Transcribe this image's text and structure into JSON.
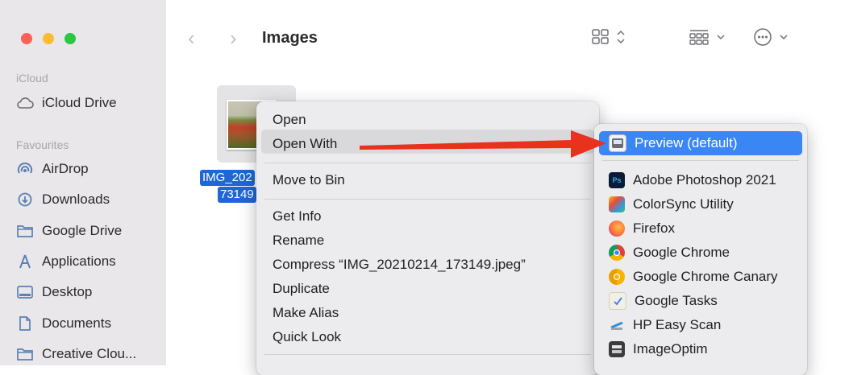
{
  "sidebar": {
    "icloud_header": "iCloud",
    "icloud_drive": "iCloud Drive",
    "favourites_header": "Favourites",
    "items": [
      {
        "label": "AirDrop",
        "icon": "airdrop-icon"
      },
      {
        "label": "Downloads",
        "icon": "downloads-icon"
      },
      {
        "label": "Google Drive",
        "icon": "folder-icon"
      },
      {
        "label": "Applications",
        "icon": "applications-icon"
      },
      {
        "label": "Desktop",
        "icon": "desktop-icon"
      },
      {
        "label": "Documents",
        "icon": "document-icon"
      },
      {
        "label": "Creative Clou...",
        "icon": "folder-icon"
      }
    ]
  },
  "toolbar": {
    "back": "‹",
    "forward": "›",
    "title": "Images"
  },
  "file": {
    "name_line1": "IMG_202",
    "name_line2": "73149"
  },
  "context_menu": {
    "open": "Open",
    "open_with": "Open With",
    "move_to_bin": "Move to Bin",
    "get_info": "Get Info",
    "rename": "Rename",
    "compress": "Compress “IMG_20210214_173149.jpeg”",
    "duplicate": "Duplicate",
    "make_alias": "Make Alias",
    "quick_look": "Quick Look"
  },
  "submenu": {
    "default_app": "Preview (default)",
    "apps": [
      {
        "label": "Adobe Photoshop 2021",
        "icon": "photoshop-icon"
      },
      {
        "label": "ColorSync Utility",
        "icon": "colorsync-icon"
      },
      {
        "label": "Firefox",
        "icon": "firefox-icon"
      },
      {
        "label": "Google Chrome",
        "icon": "chrome-icon"
      },
      {
        "label": "Google Chrome Canary",
        "icon": "chrome-canary-icon"
      },
      {
        "label": "Google Tasks",
        "icon": "google-tasks-icon"
      },
      {
        "label": "HP Easy Scan",
        "icon": "hp-easy-scan-icon"
      },
      {
        "label": "ImageOptim",
        "icon": "imageoptim-icon"
      }
    ]
  },
  "colors": {
    "accent": "#3a86f5",
    "arrow": "#e8321e",
    "selection": "#1f67d6"
  }
}
